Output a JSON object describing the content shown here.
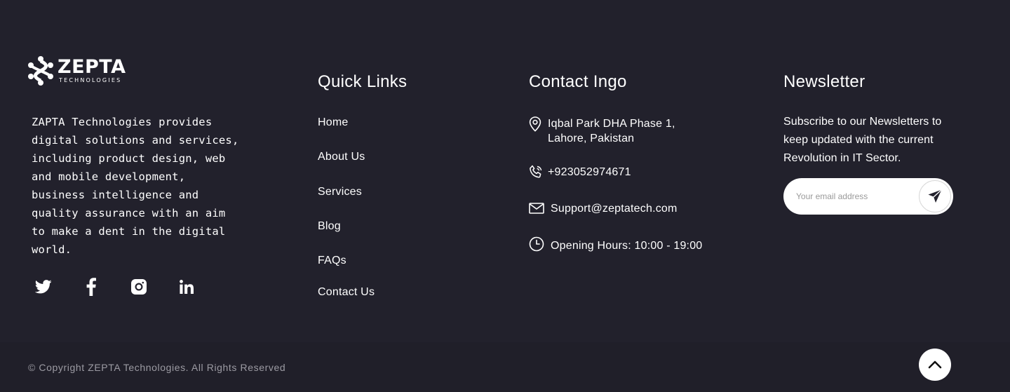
{
  "brand": {
    "name": "ZEPTA",
    "tagline": "TECHNOLOGIES",
    "description": "ZAPTA Technologies provides digital solutions and services, including product design, web and mobile development, business intelligence and quality assurance with an aim to make a dent in the digital world.",
    "socials": [
      "twitter-icon",
      "facebook-icon",
      "instagram-icon",
      "linkedin-icon"
    ]
  },
  "quick_links": {
    "title": "Quick Links",
    "items": [
      "Home",
      "About Us",
      "Services",
      "Blog",
      "FAQs",
      "Contact Us"
    ]
  },
  "contact": {
    "title": "Contact Ingo",
    "address_line1": "Iqbal Park DHA Phase 1,",
    "address_line2": "Lahore, Pakistan",
    "phone": "+923052974671",
    "email": "Support@zeptatech.com",
    "hours": "Opening Hours: 10:00 - 19:00"
  },
  "newsletter": {
    "title": "Newsletter",
    "description": "Subscribe to our Newsletters to keep updated with the current Revolution in IT Sector.",
    "placeholder": "Your email address",
    "value": ""
  },
  "footer": {
    "copyright": "© Copyright ZEPTA Technologies. All Rights Reserved"
  },
  "colors": {
    "background": "#22212c",
    "bottom_bar": "#201f29",
    "text": "#ffffff",
    "muted_text": "#9c9ba3"
  }
}
